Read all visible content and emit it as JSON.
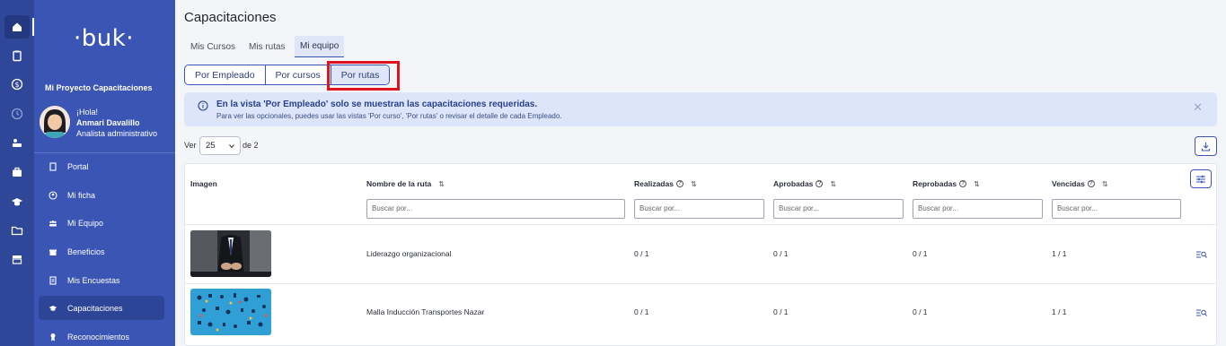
{
  "app": {
    "logo": "·buk·",
    "project": "Mi Proyecto Capacitaciones"
  },
  "user": {
    "greeting": "¡Hola!",
    "name": "Anmari Davalillo",
    "role": "Analista administrativo"
  },
  "rail": [
    "home-icon",
    "clipboard-icon",
    "dollar-icon",
    "clock-icon",
    "people-arrows-icon",
    "briefcase-icon",
    "grad-cap-icon",
    "folder-icon",
    "store-icon"
  ],
  "nav": [
    {
      "label": "Portal",
      "icon": "document-icon"
    },
    {
      "label": "Mi ficha",
      "icon": "user-circle-icon"
    },
    {
      "label": "Mi Equipo",
      "icon": "team-icon"
    },
    {
      "label": "Beneficios",
      "icon": "gift-icon"
    },
    {
      "label": "Mis Encuestas",
      "icon": "survey-icon"
    },
    {
      "label": "Capacitaciones",
      "icon": "graduation-icon",
      "active": true
    },
    {
      "label": "Reconocimientos",
      "icon": "award-icon"
    }
  ],
  "page": {
    "title": "Capacitaciones"
  },
  "tabs": [
    "Mis Cursos",
    "Mis rutas",
    "Mi equipo"
  ],
  "segments": [
    "Por Empleado",
    "Por cursos",
    "Por rutas"
  ],
  "alert": {
    "title": "En la vista 'Por Empleado' solo se muestran las capacitaciones requeridas.",
    "subtitle": "Para ver las opcionales, puedes usar las vistas 'Por curso', 'Por rutas' o revisar el detalle de cada Empleado."
  },
  "pagination": {
    "ver": "Ver",
    "per_page": "25",
    "of": "de 2"
  },
  "table": {
    "headers": [
      "Imagen",
      "Nombre de la ruta",
      "Realizadas",
      "Aprobadas",
      "Reprobadas",
      "Vencidas"
    ],
    "filter_placeholder": "Buscar por...",
    "rows": [
      {
        "name": "Liderazgo organizacional",
        "realizadas": "0 / 1",
        "aprobadas": "0 / 1",
        "reprobadas": "0 / 1",
        "vencidas": "1 / 1"
      },
      {
        "name": "Malla Inducción Transportes Nazar",
        "realizadas": "0 / 1",
        "aprobadas": "0 / 1",
        "reprobadas": "0 / 1",
        "vencidas": "1 / 1"
      }
    ]
  },
  "colors": {
    "sidebar": "#3a55b4",
    "rail": "#2f4799",
    "accent": "#3a55b4",
    "alert_bg": "#dde5fa",
    "highlight": "#e0141e"
  }
}
